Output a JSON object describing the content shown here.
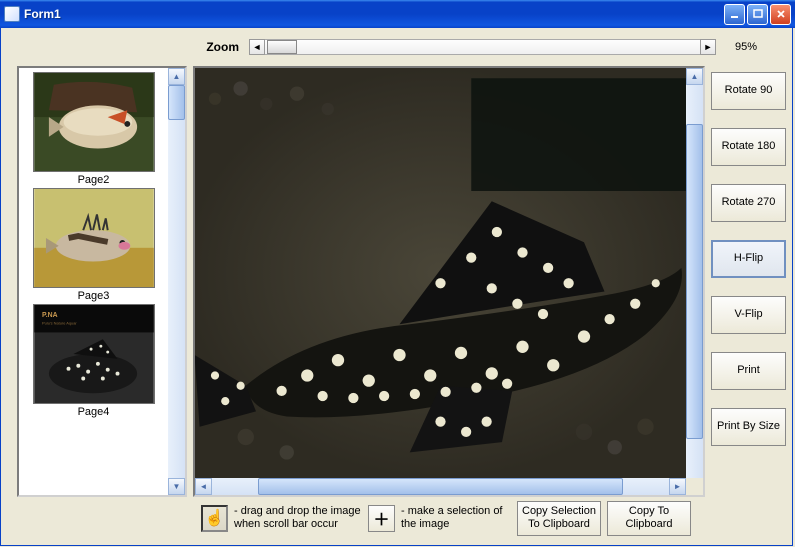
{
  "titlebar": {
    "title": "Form1"
  },
  "zoom": {
    "label": "Zoom",
    "value": "95%"
  },
  "thumbnails": [
    {
      "label": "Page2"
    },
    {
      "label": "Page3"
    },
    {
      "label": "Page4"
    }
  ],
  "buttons": {
    "rotate90": "Rotate 90",
    "rotate180": "Rotate 180",
    "rotate270": "Rotate 270",
    "hflip": "H-Flip",
    "vflip": "V-Flip",
    "print": "Print",
    "printbysize": "Print By Size"
  },
  "footer": {
    "drag_hint": "- drag and drop the image\nwhen scroll bar occur",
    "select_hint": "- make a selection of\nthe image",
    "copy_selection": "Copy Selection\nTo Clipboard",
    "copy_to_clipboard": "Copy To\nClipboard"
  }
}
